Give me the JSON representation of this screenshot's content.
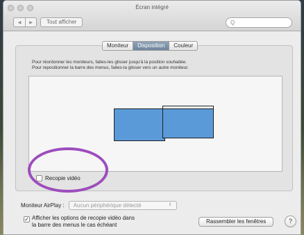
{
  "window": {
    "title": "Écran intégré"
  },
  "toolbar": {
    "back_icon": "◀",
    "forward_icon": "▶",
    "show_all_label": "Tout afficher",
    "search_placeholder": "Q"
  },
  "tabs": [
    {
      "label": "Moniteur",
      "active": false
    },
    {
      "label": "Disposition",
      "active": true
    },
    {
      "label": "Couleur",
      "active": false
    }
  ],
  "instructions": [
    "Pour réordonner les moniteurs, faites-les glisser jusqu'à la position souhaitée.",
    "Pour repositionner la barre des menus, faites-la glisser vers un autre moniteur."
  ],
  "mirror": {
    "label": "Recopie vidéo",
    "checked": false
  },
  "airplay": {
    "label": "Moniteur AirPlay :",
    "selected": "Aucun périphérique détecté",
    "arrow": "⇕"
  },
  "mirroring_options": {
    "label": "Afficher les options de recopie vidéo dans la barre des menus le cas échéant",
    "checked": true,
    "check_glyph": "✓"
  },
  "gather_windows_label": "Rassembler les fenêtres",
  "help_label": "?",
  "colors": {
    "monitor": "#5b9ad9",
    "active_tab": "#7a8fa6",
    "highlight_circle": "#9d4dbd"
  }
}
